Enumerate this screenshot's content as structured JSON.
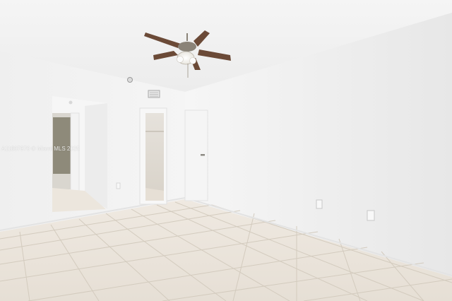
{
  "photo": {
    "watermark": "A11807970 © Miami MLS 2025",
    "colors": {
      "ceiling": "#f3f3f3",
      "left_wall": "#f0f0f0",
      "back_wall": "#f4f4f4",
      "right_wall": "#ececec",
      "floor_tile": "#ebe5dc",
      "grout": "#cfc7ba",
      "fan_blade": "#6b4a37",
      "fan_metal": "#8a8378"
    }
  }
}
